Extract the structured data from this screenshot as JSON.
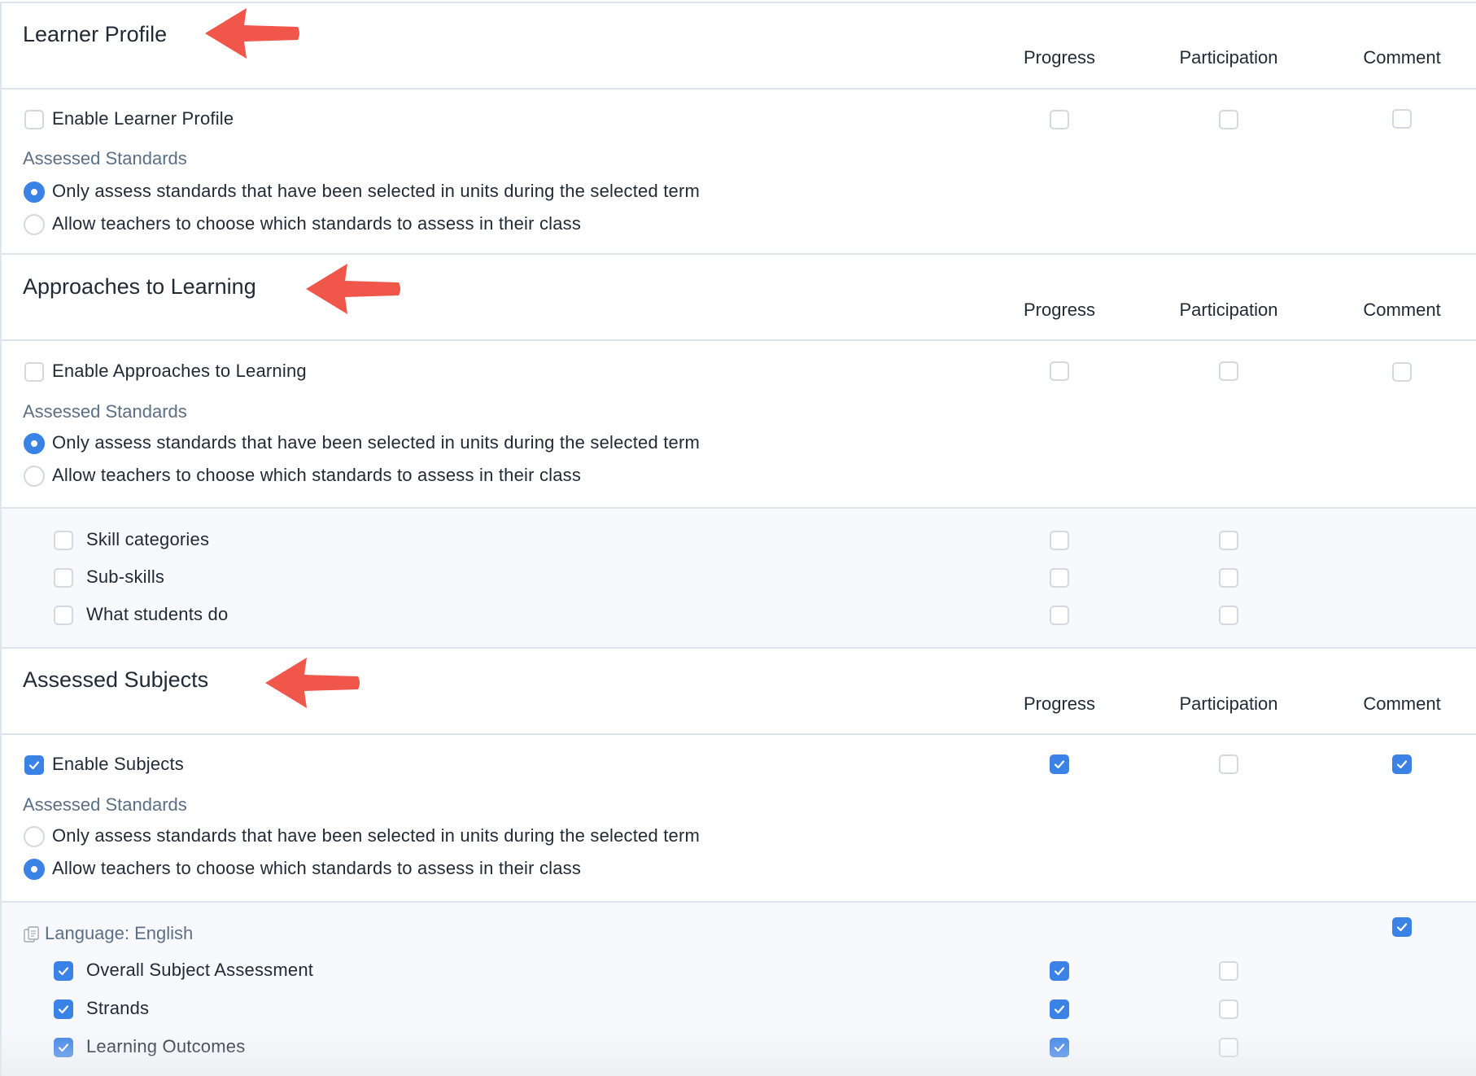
{
  "columns": {
    "progress": "Progress",
    "participation": "Participation",
    "comment": "Comment"
  },
  "sections": {
    "learner_profile": {
      "title": "Learner Profile",
      "enable": {
        "label": "Enable Learner Profile",
        "checked": false,
        "progress": false,
        "participation": false,
        "comment": false
      },
      "assessed_standards_label": "Assessed Standards",
      "options": [
        {
          "label": "Only assess standards that have been selected in units during the selected term",
          "selected": true
        },
        {
          "label": "Allow teachers to choose which standards to assess in their class",
          "selected": false
        }
      ]
    },
    "approaches": {
      "title": "Approaches to Learning",
      "enable": {
        "label": "Enable Approaches to Learning",
        "checked": false,
        "progress": false,
        "participation": false,
        "comment": false
      },
      "assessed_standards_label": "Assessed Standards",
      "options": [
        {
          "label": "Only assess standards that have been selected in units during the selected term",
          "selected": true
        },
        {
          "label": "Allow teachers to choose which standards to assess in their class",
          "selected": false
        }
      ],
      "sub_items": [
        {
          "label": "Skill categories",
          "checked": false,
          "progress": false,
          "participation": false
        },
        {
          "label": "Sub-skills",
          "checked": false,
          "progress": false,
          "participation": false
        },
        {
          "label": "What students do",
          "checked": false,
          "progress": false,
          "participation": false
        }
      ]
    },
    "subjects": {
      "title": "Assessed Subjects",
      "enable": {
        "label": "Enable Subjects",
        "checked": true,
        "progress": true,
        "participation": false,
        "comment": true
      },
      "assessed_standards_label": "Assessed Standards",
      "options": [
        {
          "label": "Only assess standards that have been selected in units during the selected term",
          "selected": false
        },
        {
          "label": "Allow teachers to choose which standards to assess in their class",
          "selected": true
        }
      ],
      "group": {
        "label": "Language: English",
        "icon": "document-icon",
        "comment": true,
        "items": [
          {
            "label": "Overall Subject Assessment",
            "checked": true,
            "progress": true,
            "participation": false
          },
          {
            "label": "Strands",
            "checked": true,
            "progress": true,
            "participation": false
          },
          {
            "label": "Learning Outcomes",
            "checked": true,
            "progress": true,
            "participation": false
          }
        ]
      }
    }
  },
  "colors": {
    "accent": "#3b82e6",
    "arrow": "#f0564a",
    "muted_label": "#5b6f85",
    "divider": "#dde5ee"
  }
}
